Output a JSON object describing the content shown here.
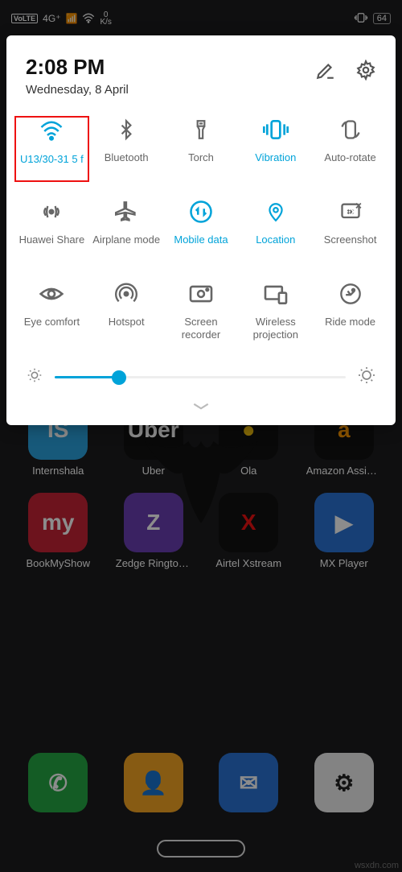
{
  "status": {
    "volte": "VoLTE",
    "signal": "4G⁺",
    "data_speed_value": "0",
    "data_speed_unit": "K/s",
    "battery_pct": "64"
  },
  "panel": {
    "time": "2:08 PM",
    "date": "Wednesday, 8 April",
    "brightness_pct": 22
  },
  "toggles": [
    {
      "id": "wifi",
      "label": "U13/30-31 5 f",
      "active": true,
      "highlight": true
    },
    {
      "id": "bluetooth",
      "label": "Bluetooth",
      "active": false
    },
    {
      "id": "torch",
      "label": "Torch",
      "active": false
    },
    {
      "id": "vibration",
      "label": "Vibration",
      "active": true
    },
    {
      "id": "autorotate",
      "label": "Auto-rotate",
      "active": false
    },
    {
      "id": "huaweishare",
      "label": "Huawei Share",
      "active": false
    },
    {
      "id": "airplane",
      "label": "Airplane mode",
      "active": false
    },
    {
      "id": "mobiledata",
      "label": "Mobile data",
      "active": true
    },
    {
      "id": "location",
      "label": "Location",
      "active": true
    },
    {
      "id": "screenshot",
      "label": "Screenshot",
      "active": false
    },
    {
      "id": "eyecomfort",
      "label": "Eye comfort",
      "active": false
    },
    {
      "id": "hotspot",
      "label": "Hotspot",
      "active": false
    },
    {
      "id": "screenrecorder",
      "label": "Screen\nrecorder",
      "active": false
    },
    {
      "id": "projection",
      "label": "Wireless\nprojection",
      "active": false
    },
    {
      "id": "ridemode",
      "label": "Ride mode",
      "active": false
    }
  ],
  "apps_row1": [
    {
      "label": "Internshala",
      "color": "#2aa3df",
      "glyph": "IS",
      "glcol": "#fff"
    },
    {
      "label": "Uber",
      "color": "#111",
      "glyph": "Uber",
      "glcol": "#fff"
    },
    {
      "label": "Ola",
      "color": "#111",
      "glyph": "●",
      "glcol": "#f4c20d"
    },
    {
      "label": "Amazon Assis…",
      "color": "#111",
      "glyph": "a",
      "glcol": "#ff9900"
    }
  ],
  "apps_row2": [
    {
      "label": "BookMyShow",
      "color": "#c62336",
      "glyph": "my",
      "glcol": "#fff"
    },
    {
      "label": "Zedge Rington…",
      "color": "#6b3fb3",
      "glyph": "Z",
      "glcol": "#fff"
    },
    {
      "label": "Airtel Xstream",
      "color": "#111",
      "glyph": "X",
      "glcol": "#e11"
    },
    {
      "label": "MX Player",
      "color": "#2a74d6",
      "glyph": "▶",
      "glcol": "#fff"
    }
  ],
  "dock": [
    {
      "id": "phone",
      "color": "#26a844",
      "glyph": "✆",
      "glcol": "#fff"
    },
    {
      "id": "contacts",
      "color": "#f6a623",
      "glyph": "👤",
      "glcol": "#fff"
    },
    {
      "id": "messages",
      "color": "#2a74d6",
      "glyph": "✉",
      "glcol": "#fff"
    },
    {
      "id": "settings",
      "color": "#eee",
      "glyph": "⚙",
      "glcol": "#222"
    }
  ],
  "watermark": "wsxdn.com"
}
